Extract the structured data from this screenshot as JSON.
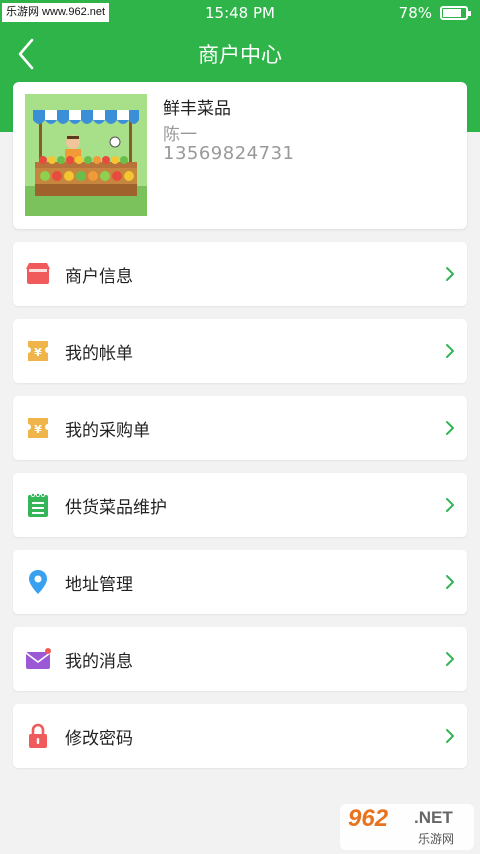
{
  "status_bar": {
    "watermark": "乐游网 www.962.net",
    "time": "15:48 PM",
    "battery": "78%",
    "battery_level": 0.78
  },
  "header": {
    "title": "商户中心",
    "color": "#2fb44a"
  },
  "profile": {
    "shop_name": "鲜丰菜品",
    "owner": "陈一",
    "phone": "13569824731"
  },
  "menu": [
    {
      "label": "商户信息",
      "icon": "store-icon",
      "color": "#f05a5a"
    },
    {
      "label": "我的帐单",
      "icon": "yen-ticket-icon",
      "color": "#f0b54a"
    },
    {
      "label": "我的采购单",
      "icon": "yen-ticket-icon",
      "color": "#f0b54a"
    },
    {
      "label": "供货菜品维护",
      "icon": "notepad-icon",
      "color": "#34b557"
    },
    {
      "label": "地址管理",
      "icon": "location-pin-icon",
      "color": "#3aa0f0"
    },
    {
      "label": "我的消息",
      "icon": "mail-icon",
      "color": "#9b59d6"
    },
    {
      "label": "修改密码",
      "icon": "lock-icon",
      "color": "#f05a5a"
    }
  ],
  "watermark": {
    "logo": "962",
    "suffix": ".NET",
    "caption": "乐游网"
  }
}
